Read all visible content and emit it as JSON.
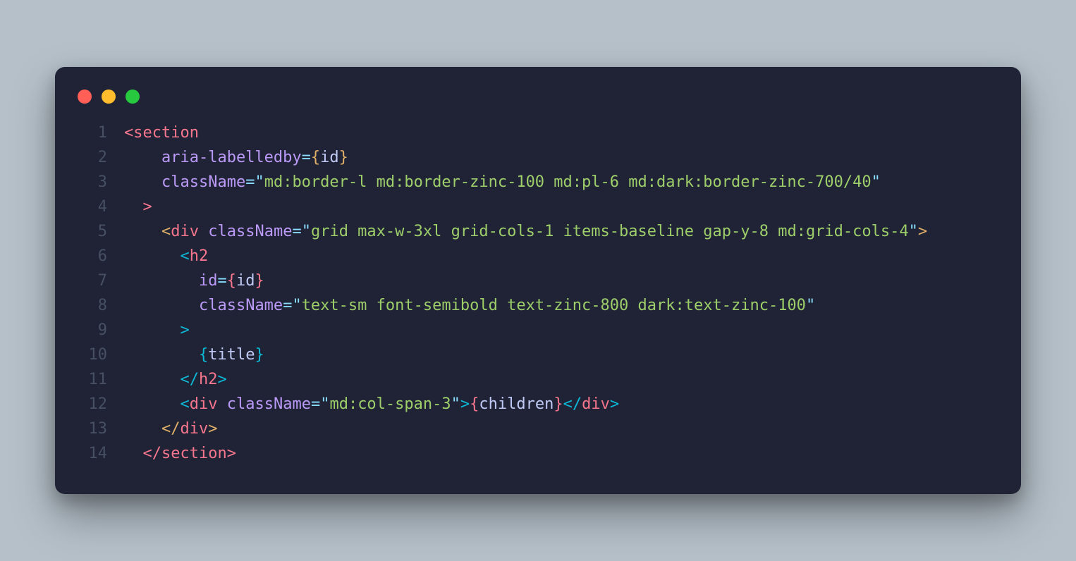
{
  "window": {
    "traffic_lights": [
      "red",
      "yellow",
      "green"
    ]
  },
  "code": {
    "line_numbers": [
      "1",
      "2",
      "3",
      "4",
      "5",
      "6",
      "7",
      "8",
      "9",
      "10",
      "11",
      "12",
      "13",
      "14"
    ],
    "lines": [
      {
        "n": "1",
        "tokens": [
          {
            "t": "<",
            "c": "bracket-pink"
          },
          {
            "t": "section",
            "c": "tag"
          }
        ]
      },
      {
        "n": "2",
        "tokens": [
          {
            "t": "    ",
            "c": "plain"
          },
          {
            "t": "aria-labelledby",
            "c": "attr"
          },
          {
            "t": "=",
            "c": "operator"
          },
          {
            "t": "{",
            "c": "bracket-yellow"
          },
          {
            "t": "id",
            "c": "expr"
          },
          {
            "t": "}",
            "c": "bracket-yellow"
          }
        ]
      },
      {
        "n": "3",
        "tokens": [
          {
            "t": "    ",
            "c": "plain"
          },
          {
            "t": "className",
            "c": "attr"
          },
          {
            "t": "=",
            "c": "operator"
          },
          {
            "t": "\"",
            "c": "punct"
          },
          {
            "t": "md:border-l md:border-zinc-100 md:pl-6 md:dark:border-zinc-700/40",
            "c": "string"
          },
          {
            "t": "\"",
            "c": "punct"
          }
        ]
      },
      {
        "n": "4",
        "tokens": [
          {
            "t": "  ",
            "c": "plain"
          },
          {
            "t": ">",
            "c": "bracket-pink"
          }
        ]
      },
      {
        "n": "5",
        "tokens": [
          {
            "t": "    ",
            "c": "plain"
          },
          {
            "t": "<",
            "c": "bracket-yellow"
          },
          {
            "t": "div",
            "c": "tag"
          },
          {
            "t": " ",
            "c": "plain"
          },
          {
            "t": "className",
            "c": "attr"
          },
          {
            "t": "=",
            "c": "operator"
          },
          {
            "t": "\"",
            "c": "punct"
          },
          {
            "t": "grid max-w-3xl grid-cols-1 items-baseline gap-y-8 md:grid-cols-4",
            "c": "string"
          },
          {
            "t": "\"",
            "c": "punct"
          },
          {
            "t": ">",
            "c": "bracket-yellow"
          }
        ]
      },
      {
        "n": "6",
        "tokens": [
          {
            "t": "      ",
            "c": "plain"
          },
          {
            "t": "<",
            "c": "bracket-teal"
          },
          {
            "t": "h2",
            "c": "tag"
          }
        ]
      },
      {
        "n": "7",
        "tokens": [
          {
            "t": "        ",
            "c": "plain"
          },
          {
            "t": "id",
            "c": "attr"
          },
          {
            "t": "=",
            "c": "operator"
          },
          {
            "t": "{",
            "c": "bracket-pink"
          },
          {
            "t": "id",
            "c": "expr"
          },
          {
            "t": "}",
            "c": "bracket-pink"
          }
        ]
      },
      {
        "n": "8",
        "tokens": [
          {
            "t": "        ",
            "c": "plain"
          },
          {
            "t": "className",
            "c": "attr"
          },
          {
            "t": "=",
            "c": "operator"
          },
          {
            "t": "\"",
            "c": "punct"
          },
          {
            "t": "text-sm font-semibold text-zinc-800 dark:text-zinc-100",
            "c": "string"
          },
          {
            "t": "\"",
            "c": "punct"
          }
        ]
      },
      {
        "n": "9",
        "tokens": [
          {
            "t": "      ",
            "c": "plain"
          },
          {
            "t": ">",
            "c": "bracket-teal"
          }
        ]
      },
      {
        "n": "10",
        "tokens": [
          {
            "t": "        ",
            "c": "plain"
          },
          {
            "t": "{",
            "c": "bracket-teal"
          },
          {
            "t": "title",
            "c": "expr"
          },
          {
            "t": "}",
            "c": "bracket-teal"
          }
        ]
      },
      {
        "n": "11",
        "tokens": [
          {
            "t": "      ",
            "c": "plain"
          },
          {
            "t": "</",
            "c": "bracket-teal"
          },
          {
            "t": "h2",
            "c": "tag"
          },
          {
            "t": ">",
            "c": "bracket-teal"
          }
        ]
      },
      {
        "n": "12",
        "tokens": [
          {
            "t": "      ",
            "c": "plain"
          },
          {
            "t": "<",
            "c": "bracket-teal"
          },
          {
            "t": "div",
            "c": "tag"
          },
          {
            "t": " ",
            "c": "plain"
          },
          {
            "t": "className",
            "c": "attr"
          },
          {
            "t": "=",
            "c": "operator"
          },
          {
            "t": "\"",
            "c": "punct"
          },
          {
            "t": "md:col-span-3",
            "c": "string"
          },
          {
            "t": "\"",
            "c": "punct"
          },
          {
            "t": ">",
            "c": "bracket-teal"
          },
          {
            "t": "{",
            "c": "bracket-pink"
          },
          {
            "t": "children",
            "c": "expr"
          },
          {
            "t": "}",
            "c": "bracket-pink"
          },
          {
            "t": "</",
            "c": "bracket-teal"
          },
          {
            "t": "div",
            "c": "tag"
          },
          {
            "t": ">",
            "c": "bracket-teal"
          }
        ]
      },
      {
        "n": "13",
        "tokens": [
          {
            "t": "    ",
            "c": "plain"
          },
          {
            "t": "</",
            "c": "bracket-yellow"
          },
          {
            "t": "div",
            "c": "tag"
          },
          {
            "t": ">",
            "c": "bracket-yellow"
          }
        ]
      },
      {
        "n": "14",
        "tokens": [
          {
            "t": "  ",
            "c": "plain"
          },
          {
            "t": "</",
            "c": "bracket-pink"
          },
          {
            "t": "section",
            "c": "tag"
          },
          {
            "t": ">",
            "c": "bracket-pink"
          }
        ]
      }
    ]
  }
}
